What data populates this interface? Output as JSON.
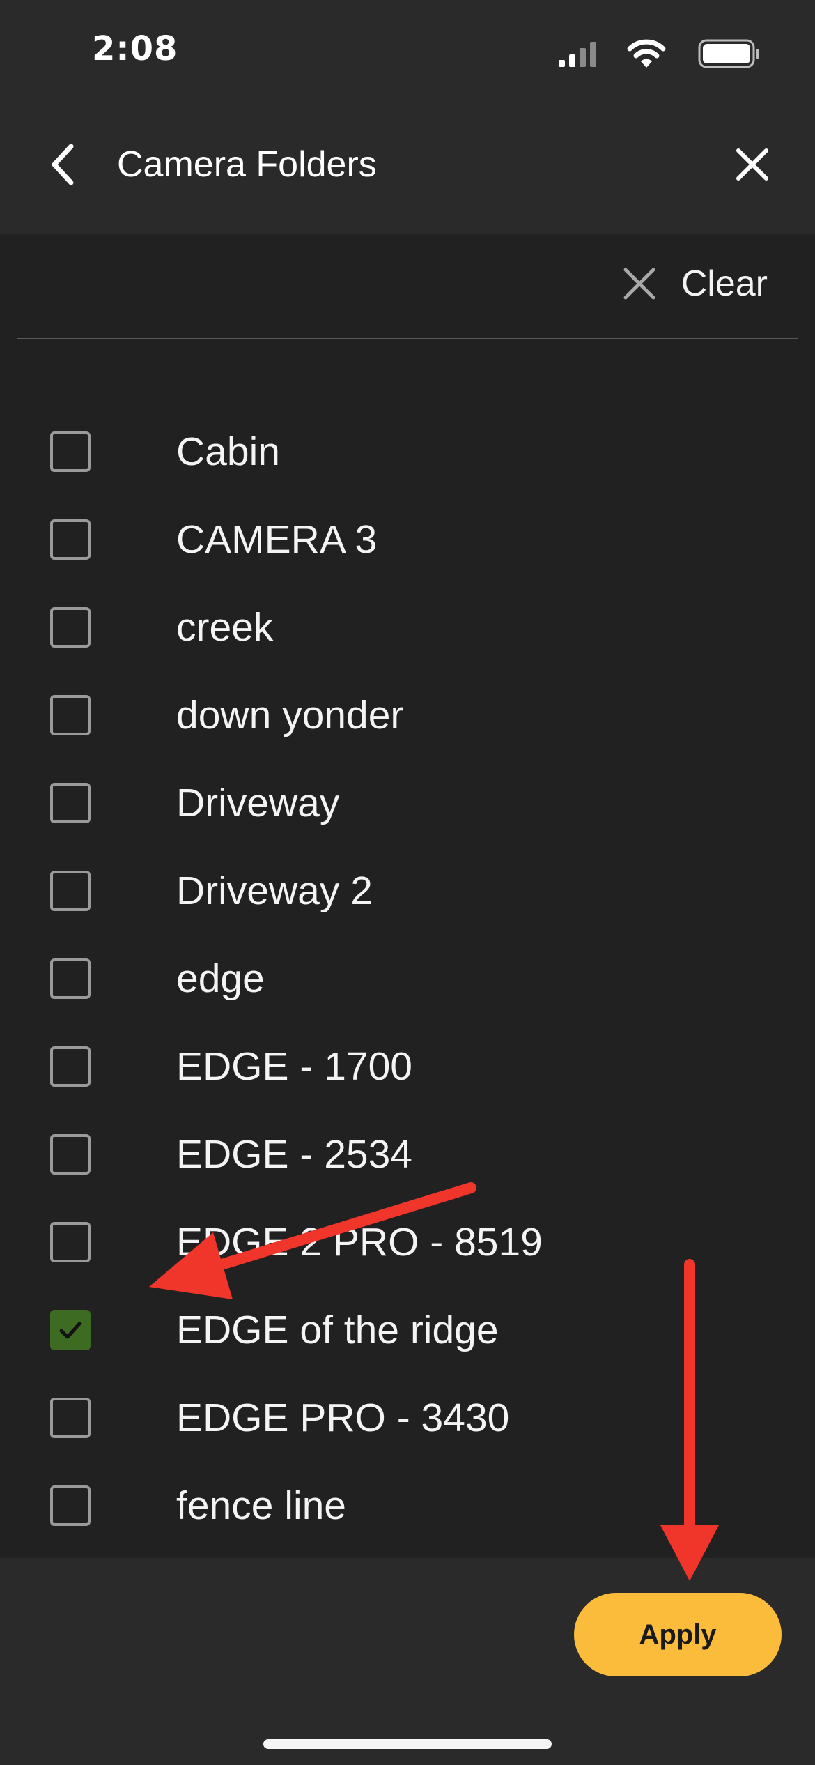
{
  "status_bar": {
    "time": "2:08"
  },
  "nav": {
    "title": "Camera Folders",
    "back_icon": "chevron-left-icon",
    "close_icon": "close-icon"
  },
  "filter": {
    "clear_label": "Clear",
    "clear_icon": "close-icon"
  },
  "folders": [
    {
      "label": "Cabin",
      "checked": false
    },
    {
      "label": "CAMERA 3",
      "checked": false
    },
    {
      "label": "creek",
      "checked": false
    },
    {
      "label": "down yonder",
      "checked": false
    },
    {
      "label": "Driveway",
      "checked": false
    },
    {
      "label": "Driveway 2",
      "checked": false
    },
    {
      "label": "edge",
      "checked": false
    },
    {
      "label": "EDGE - 1700",
      "checked": false
    },
    {
      "label": "EDGE - 2534",
      "checked": false
    },
    {
      "label": "EDGE 2 PRO - 8519",
      "checked": false
    },
    {
      "label": "EDGE of the ridge",
      "checked": true
    },
    {
      "label": "EDGE PRO - 3430",
      "checked": false
    },
    {
      "label": "fence line",
      "checked": false
    }
  ],
  "footer": {
    "apply_label": "Apply"
  },
  "colors": {
    "background": "#212121",
    "bar": "#2a2a2a",
    "accent": "#fbbb3b",
    "checked": "#3e6b22",
    "annotation_arrow": "#f0352b"
  }
}
